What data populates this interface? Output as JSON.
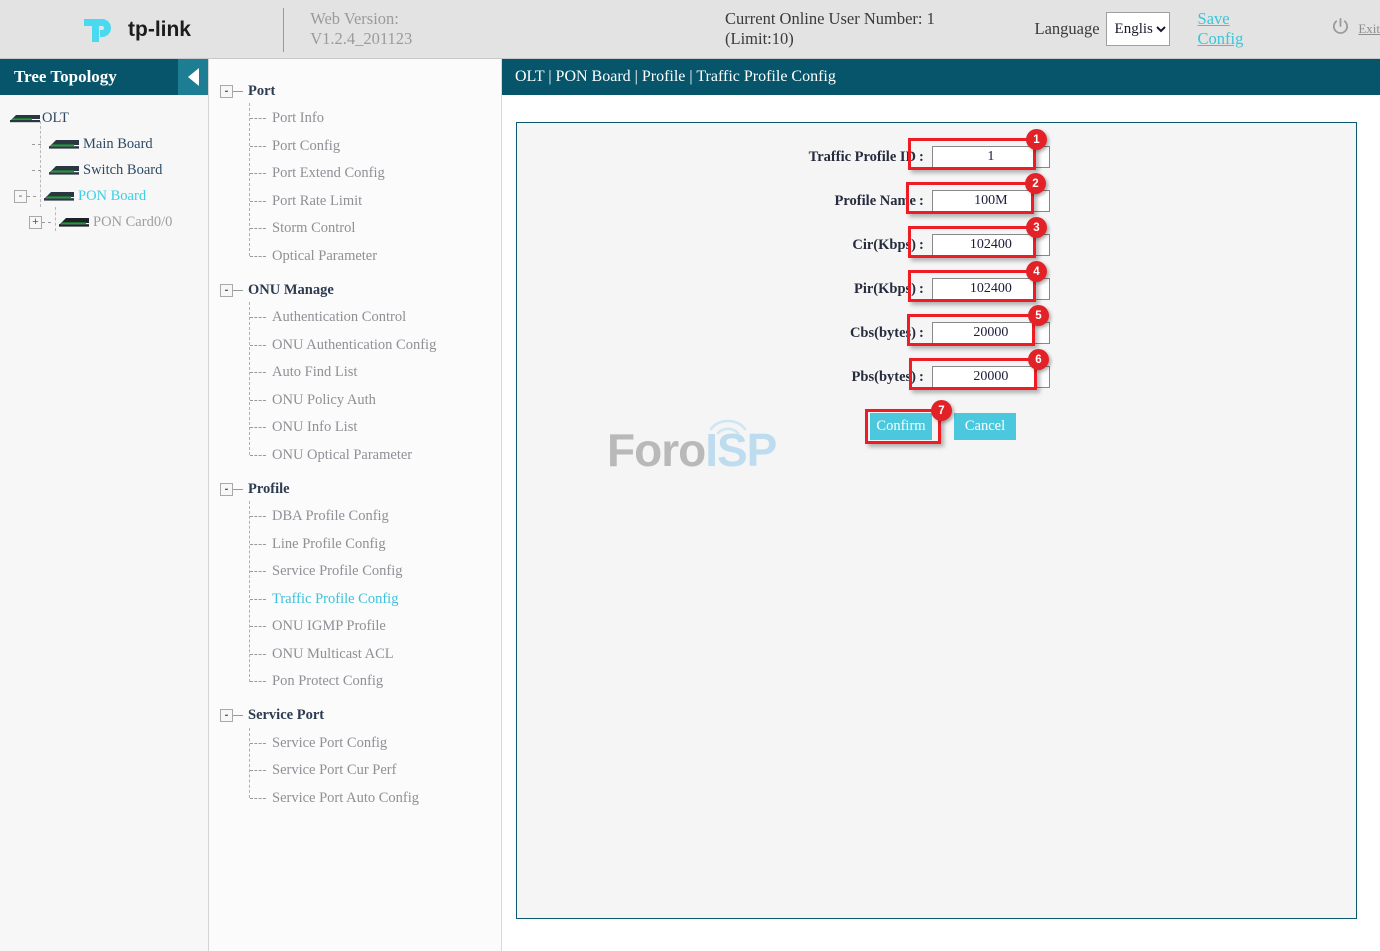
{
  "header": {
    "brand": "tp-link",
    "web_version": "Web Version: V1.2.4_201123",
    "online_users": "Current Online User Number: 1 (Limit:10)",
    "language_label": "Language",
    "language_value": "English",
    "language_options": [
      "English"
    ],
    "save_config": "Save Config",
    "exit": "Exit"
  },
  "sidebar": {
    "title": "Tree Topology",
    "nodes": [
      {
        "label": "OLT",
        "state": "normal"
      },
      {
        "label": "Main Board",
        "state": "normal"
      },
      {
        "label": "Switch Board",
        "state": "normal"
      },
      {
        "label": "PON Board",
        "state": "active"
      },
      {
        "label": "PON Card0/0",
        "state": "muted"
      }
    ],
    "expander_minus": "-",
    "expander_plus": "+"
  },
  "menu": {
    "groups": [
      {
        "label": "Port",
        "items": [
          "Port Info",
          "Port Config",
          "Port Extend Config",
          "Port Rate Limit",
          "Storm Control",
          "Optical Parameter"
        ]
      },
      {
        "label": "ONU Manage",
        "items": [
          "Authentication Control",
          "ONU Authentication Config",
          "Auto Find List",
          "ONU Policy Auth",
          "ONU Info List",
          "ONU Optical Parameter"
        ]
      },
      {
        "label": "Profile",
        "items": [
          "DBA Profile Config",
          "Line Profile Config",
          "Service Profile Config",
          "Traffic Profile Config",
          "ONU IGMP Profile",
          "ONU Multicast ACL",
          "Pon Protect Config"
        ],
        "active_item": "Traffic Profile Config"
      },
      {
        "label": "Service Port",
        "items": [
          "Service Port Config",
          "Service Port Cur Perf",
          "Service Port Auto Config"
        ]
      }
    ]
  },
  "content": {
    "breadcrumb": "OLT | PON Board | Profile | Traffic Profile Config",
    "watermark_part1": "Foro",
    "watermark_part2": "ISP",
    "form": {
      "fields": [
        {
          "label": "Traffic Profile ID",
          "value": "1",
          "badge": "1"
        },
        {
          "label": "Profile Name",
          "value": "100M",
          "badge": "2"
        },
        {
          "label": "Cir(Kbps)",
          "value": "102400",
          "badge": "3"
        },
        {
          "label": "Pir(Kbps)",
          "value": "102400",
          "badge": "4"
        },
        {
          "label": "Cbs(bytes)",
          "value": "20000",
          "badge": "5"
        },
        {
          "label": "Pbs(bytes)",
          "value": "20000",
          "badge": "6"
        }
      ],
      "colon": ":",
      "confirm_label": "Confirm",
      "confirm_badge": "7",
      "cancel_label": "Cancel"
    }
  },
  "colors": {
    "brand_cyan": "#4ad9ee",
    "header_bg": "#e3e3e3",
    "teal_bar": "#06556b",
    "accent_link": "#39c6d8",
    "button_cyan": "#4bc8dd",
    "annotation_red": "#ee1c25",
    "badge_red": "#e32227"
  }
}
